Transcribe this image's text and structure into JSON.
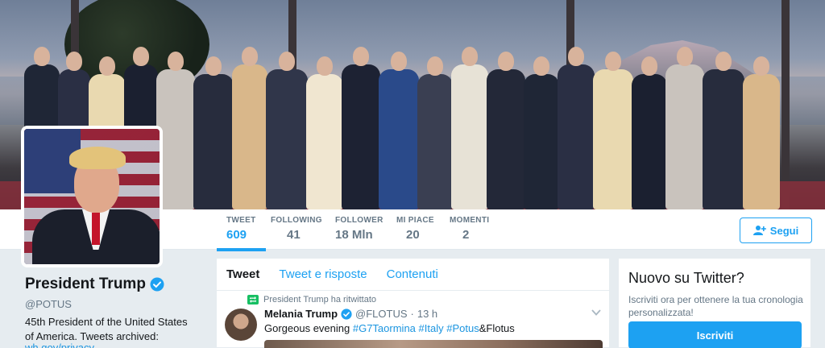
{
  "profile": {
    "name": "President Trump",
    "handle": "@POTUS",
    "bio": "45th President of the United States of America. Tweets archived:",
    "bio_link": "wh.gov/privacy"
  },
  "stats": [
    {
      "label": "TWEET",
      "value": "609"
    },
    {
      "label": "FOLLOWING",
      "value": "41"
    },
    {
      "label": "FOLLOWER",
      "value": "18 Mln"
    },
    {
      "label": "MI PIACE",
      "value": "20"
    },
    {
      "label": "MOMENTI",
      "value": "2"
    }
  ],
  "follow_button": {
    "label": "Segui"
  },
  "timeline": {
    "tabs": [
      "Tweet",
      "Tweet e risposte",
      "Contenuti"
    ],
    "retweet_notice": "President Trump ha ritwittato",
    "tweet": {
      "display_name": "Melania Trump",
      "handle": "@FLOTUS",
      "separator": "·",
      "time": "13 h",
      "text_parts": [
        "Gorgeous evening ",
        "#G7Taormina",
        " ",
        "#Italy",
        " ",
        "#Potus",
        "&Flotus"
      ]
    }
  },
  "signup": {
    "title": "Nuovo su Twitter?",
    "text": "Iscriviti ora per ottenere la tua cronologia personalizzata!",
    "button": "Iscriviti"
  },
  "colors": {
    "accent": "#1da1f2",
    "link": "#1b95e0",
    "retweet": "#17bf63",
    "muted": "#657786"
  },
  "icons": {
    "verified": "verified-badge-icon",
    "follow": "add-user-icon",
    "retweet": "retweet-icon",
    "caret": "chevron-down-icon"
  }
}
